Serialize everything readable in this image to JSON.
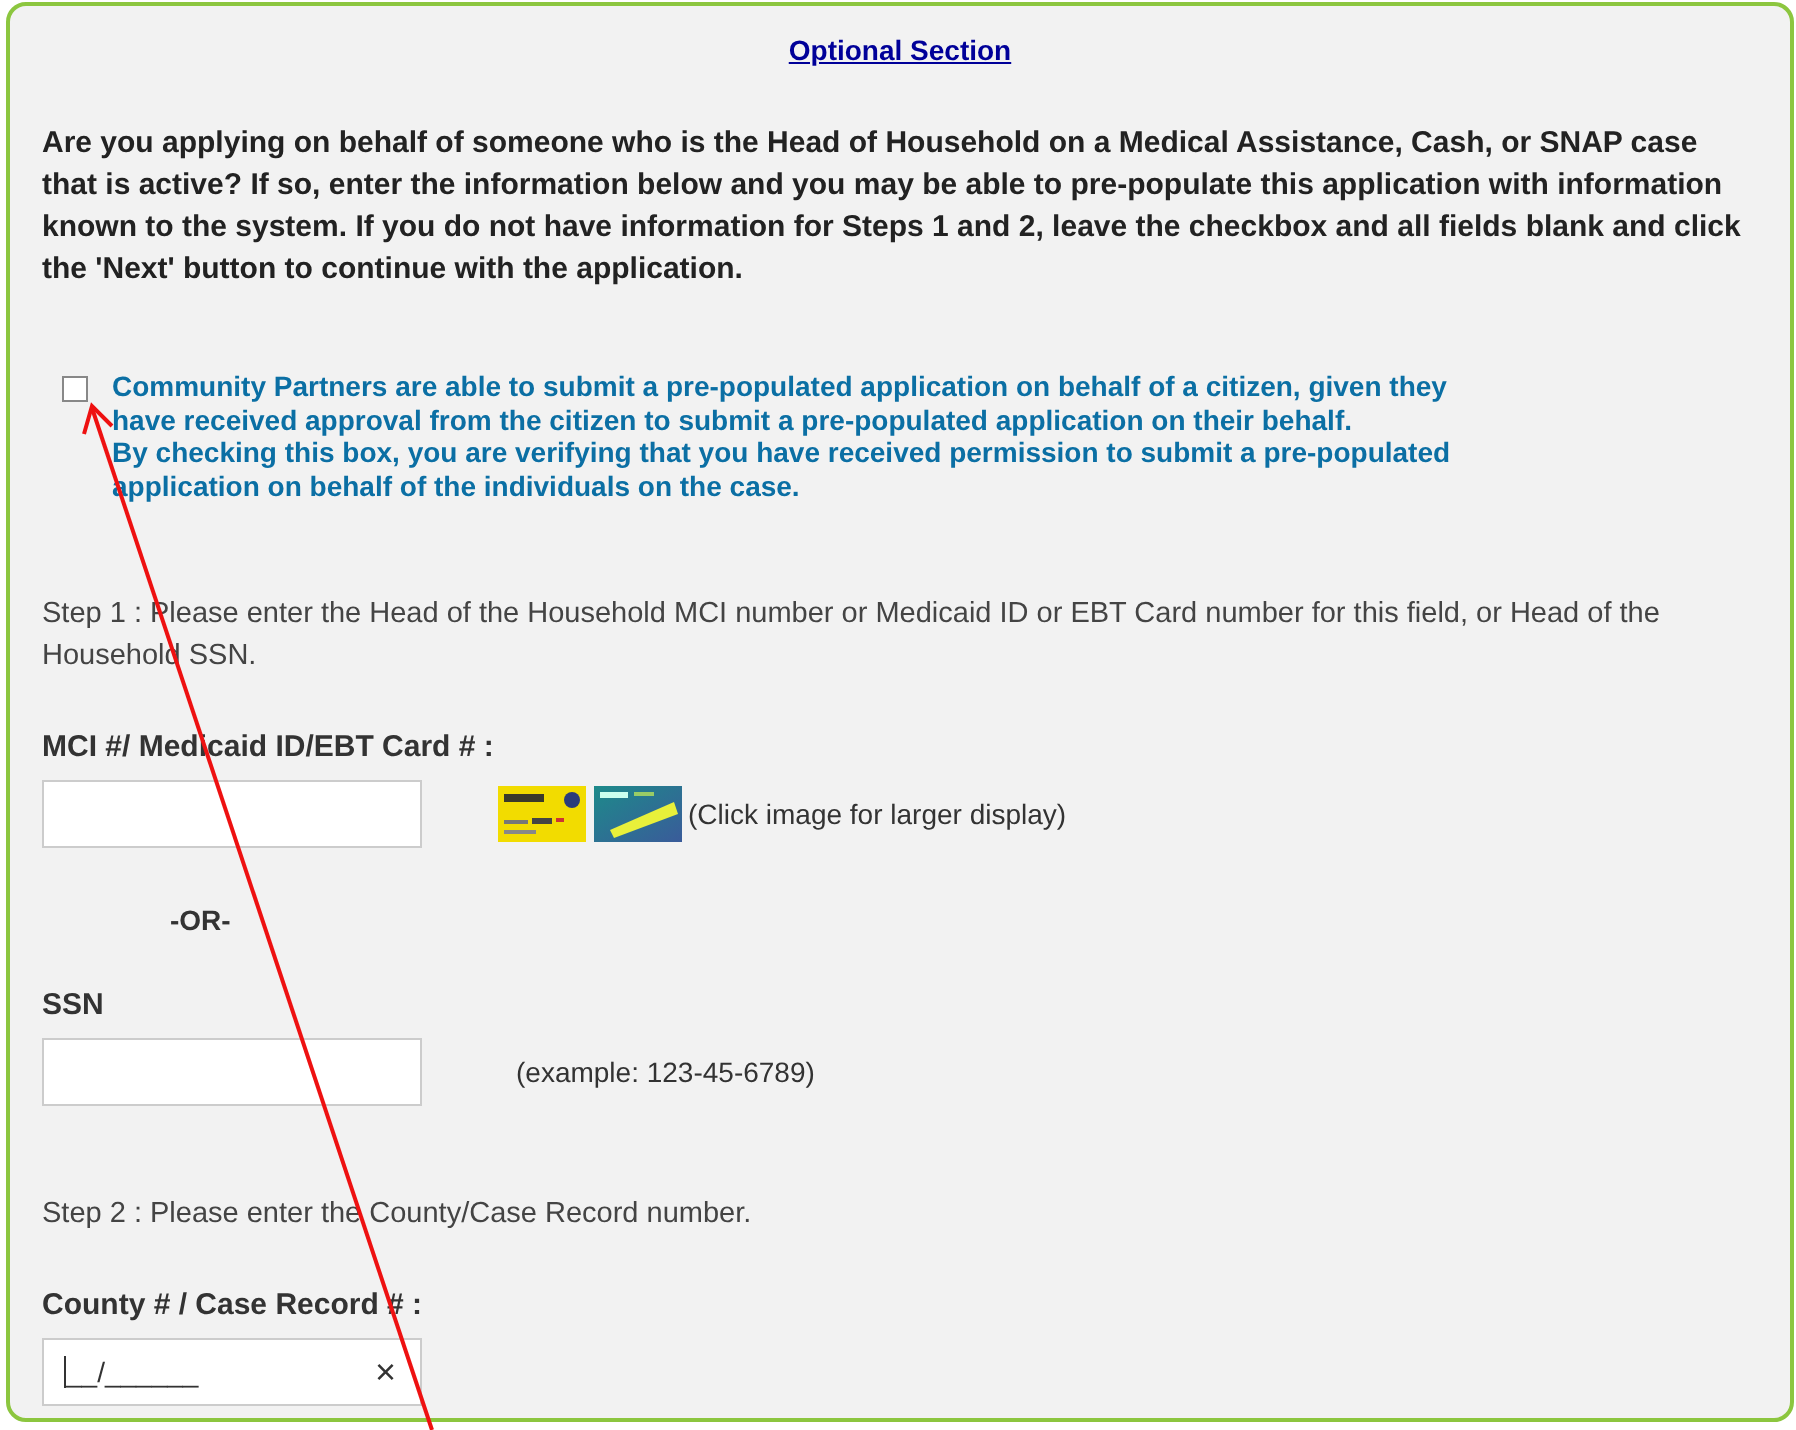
{
  "section_title": "Optional Section",
  "intro": "Are you applying on behalf of someone who is the Head of Household on a Medical Assistance, Cash, or SNAP case that is active? If so, enter the information below and you may be able to pre-populate this application with information known to the system. If you do not have information for Steps 1 and 2, leave the checkbox and all fields blank and click the 'Next' button to continue with the application.",
  "consent": {
    "checked": false,
    "lines": [
      "Community Partners are able to submit a pre-populated application on behalf of a citizen, given they have received approval from the citizen to submit a pre-populated application on their behalf.",
      "By checking this box, you are verifying that you have received permission to submit a pre-populated application on behalf of the individuals on the case."
    ]
  },
  "step1": "Step 1 : Please enter the Head of the Household MCI number or Medicaid ID or EBT Card number for this field, or Head of the Household SSN.",
  "mci": {
    "label": "MCI #/ Medicaid ID/EBT Card # :",
    "hint": "(Click image for larger display)"
  },
  "or": "-OR-",
  "ssn": {
    "label": "SSN",
    "hint": "(example: 123-45-6789)"
  },
  "step2": "Step 2 : Please enter the County/Case Record number.",
  "case": {
    "label": "County # / Case Record # :",
    "value": "__/______",
    "clear": "×"
  }
}
